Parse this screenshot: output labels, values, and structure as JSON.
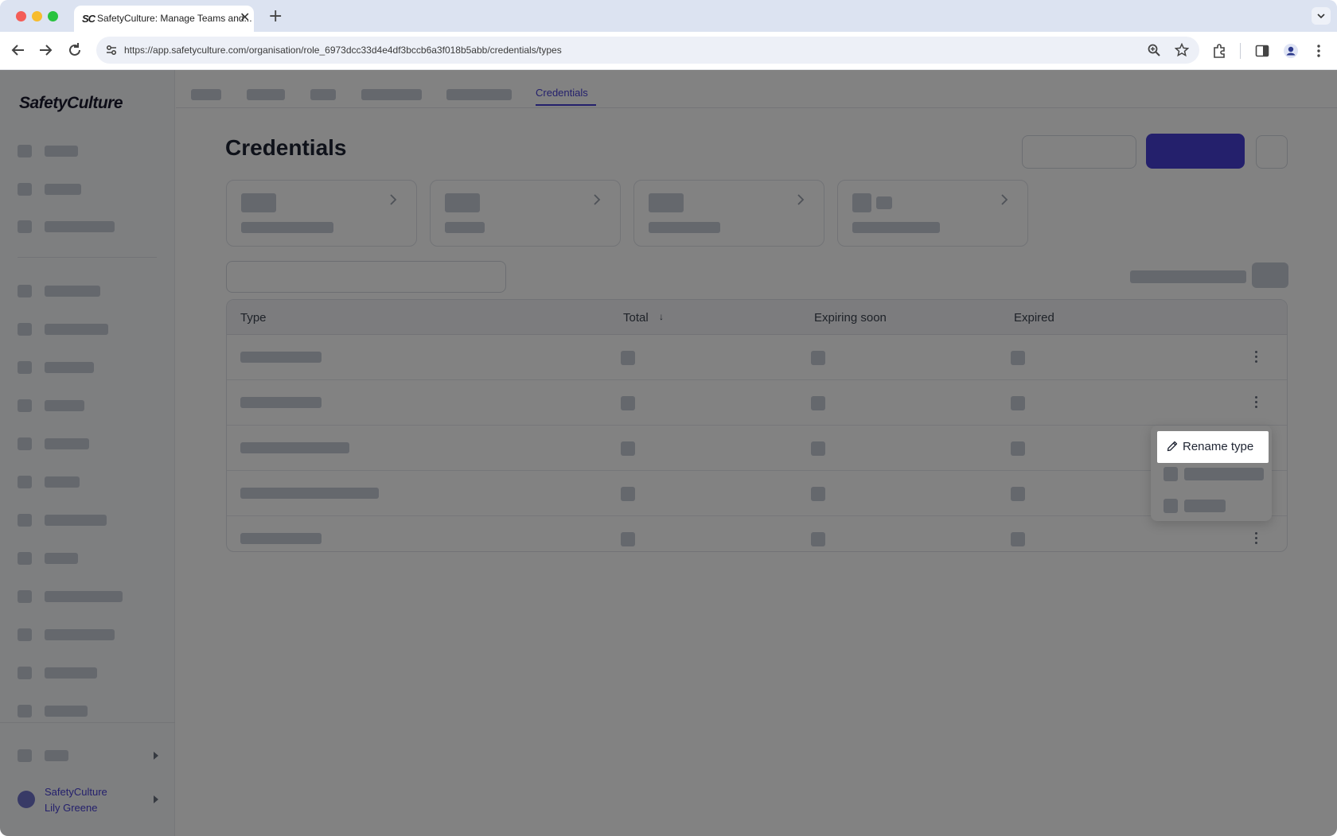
{
  "browser": {
    "tab_favicon": "SC",
    "tab_title": "SafetyCulture: Manage Teams and...",
    "tab_close": "✕",
    "new_tab": "+",
    "url": "https://app.safetyculture.com/organisation/role_6973dcc33d4e4df3bccb6a3f018b5abb/credentials/types"
  },
  "sidebar": {
    "logo": "SafetyCulture",
    "user_org": "SafetyCulture",
    "user_name": "Lily Greene"
  },
  "topnav": {
    "active_tab": "Credentials"
  },
  "main": {
    "title": "Credentials",
    "table": {
      "headers": {
        "type": "Type",
        "total": "Total",
        "expiring": "Expiring soon",
        "expired": "Expired"
      },
      "sort_icon": "↓"
    }
  },
  "context_menu": {
    "highlighted_item": "Rename type",
    "highlighted_icon": "pencil-icon"
  },
  "colors": {
    "brand": "#4740d4",
    "overlay": "rgba(0,0,0,0.49)"
  }
}
